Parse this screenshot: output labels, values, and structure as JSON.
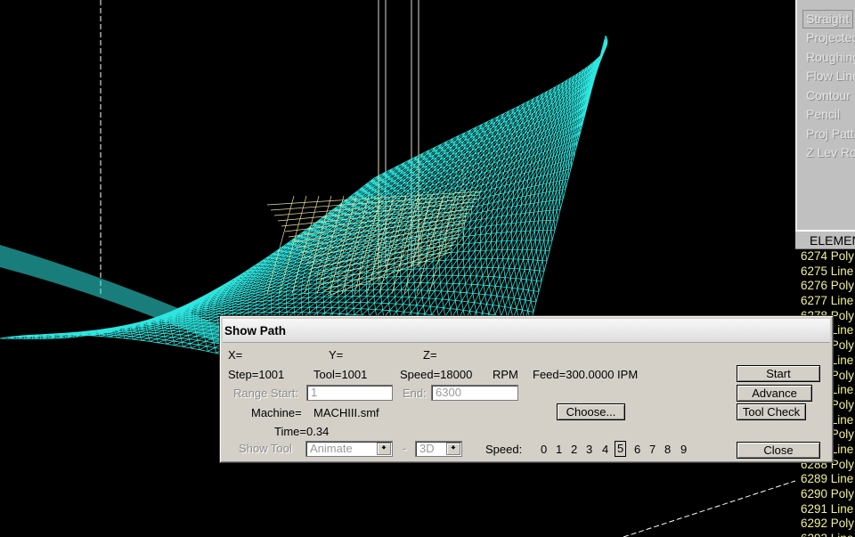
{
  "menu": {
    "items": [
      "Straight",
      "Projected",
      "Roughing",
      "Flow Line",
      "Contour",
      "Pencil",
      "Proj Patt",
      "Z Lev Ro"
    ]
  },
  "elements": {
    "header": "ELEMEN",
    "rows": [
      "6274 Poly",
      "6275 Line",
      "6276 Poly",
      "6277 Line",
      "6278 Poly",
      "6279 Line",
      "6280 Poly",
      "6281 Line",
      "6282 Poly",
      "6283 Line",
      "6284 Poly",
      "6285 Line",
      "6286 Poly",
      "6287 Line",
      "6288 Poly",
      "6289 Line",
      "6290 Poly",
      "6291 Line",
      "6292 Poly",
      "6293 Line"
    ]
  },
  "dialog": {
    "title": "Show Path",
    "x_label": "X=",
    "y_label": "Y=",
    "z_label": "Z=",
    "step": "Step=1001",
    "tool": "Tool=1001",
    "speed": "Speed=18000",
    "rpm": "RPM",
    "feed": "Feed=300.0000 IPM",
    "range_start_label": "Range Start:",
    "range_start_value": "1",
    "end_label": "End:",
    "end_value": "6300",
    "machine_label": "Machine=",
    "machine_value": "MACHIII.smf",
    "time": "Time=0.34",
    "show_tool_label": "Show Tool",
    "show_tool_value": "Animate",
    "dash": "-",
    "view_value": "3D",
    "speed_label": "Speed:",
    "speed_options": [
      "0",
      "1",
      "2",
      "3",
      "4",
      "5",
      "6",
      "7",
      "8",
      "9"
    ],
    "speed_selected": "5",
    "buttons": {
      "start": "Start",
      "advance": "Advance",
      "tool_check": "Tool Check",
      "choose": "Choose...",
      "close": "Close"
    }
  },
  "colors": {
    "mesh": "#2ee6e0",
    "toolpath": "#e8e0a0",
    "element_text": "#f0f096"
  }
}
